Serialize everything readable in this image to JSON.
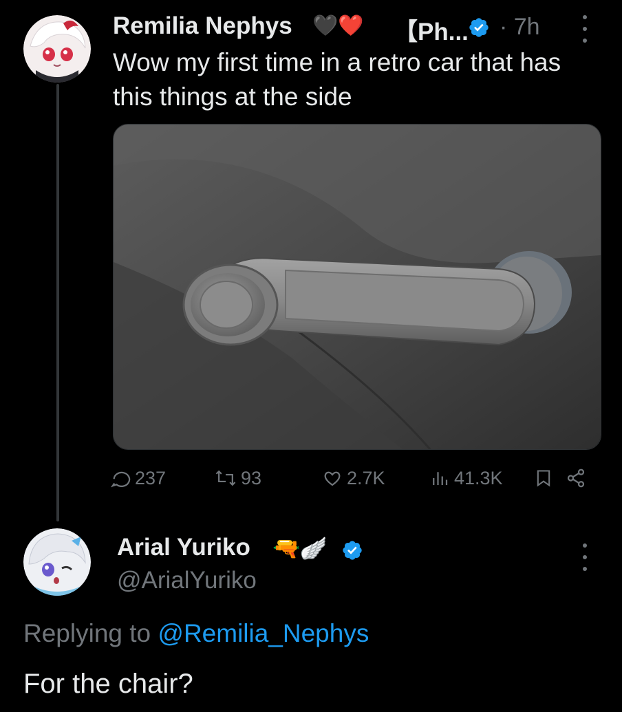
{
  "tweet": {
    "author_name": "Remilia Nephys",
    "author_emoji": "🖤❤️",
    "author_tag": "【Ph...",
    "time": "· 7h",
    "text": "Wow my first time in a retro car that has this things at the side",
    "media_icon": "car-window-crank-photo",
    "actions": {
      "replies": "237",
      "retweets": "93",
      "likes": "2.7K",
      "views": "41.3K"
    }
  },
  "reply": {
    "author_name": "Arial Yuriko",
    "author_emoji": "🔫🪽",
    "handle": "@ArialYuriko",
    "replying_prefix": "Replying to",
    "replying_to": "@Remilia_Nephys",
    "text": "For the chair?"
  },
  "colors": {
    "background": "#000000",
    "text": "#e7e9ea",
    "muted": "#71767b",
    "accent": "#1d9bf0"
  }
}
